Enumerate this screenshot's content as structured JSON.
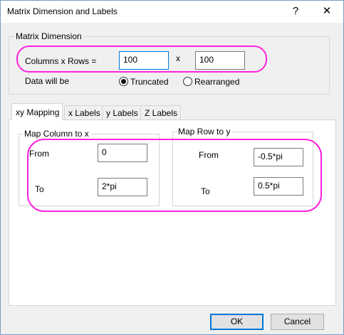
{
  "window": {
    "title": "Matrix Dimension and Labels",
    "help_glyph": "?",
    "close_glyph": "✕"
  },
  "matrix_dimension": {
    "group_title": "Matrix Dimension",
    "columns_x_rows_label": "Columns  x  Rows  =",
    "columns_value": "100",
    "x_separator": "x",
    "rows_value": "100",
    "data_will_be_label": "Data will be",
    "options": [
      {
        "label": "Truncated",
        "checked": true
      },
      {
        "label": "Rearranged",
        "checked": false
      }
    ]
  },
  "tabs": [
    {
      "label": "xy Mapping",
      "active": true
    },
    {
      "label": "x Labels",
      "active": false
    },
    {
      "label": "y Labels",
      "active": false
    },
    {
      "label": "Z Labels",
      "active": false
    }
  ],
  "map_column": {
    "group_title": "Map Column to x",
    "from_label": "From",
    "from_value": "0",
    "to_label": "To",
    "to_value": "2*pi"
  },
  "map_row": {
    "group_title": "Map Row to y",
    "from_label": "From",
    "from_value": "-0.5*pi",
    "to_label": "To",
    "to_value": "0.5*pi"
  },
  "buttons": {
    "ok": "OK",
    "cancel": "Cancel"
  },
  "colors": {
    "highlight": "#ff22dd",
    "focus": "#0078d7",
    "window_border": "#7a9cc9"
  }
}
